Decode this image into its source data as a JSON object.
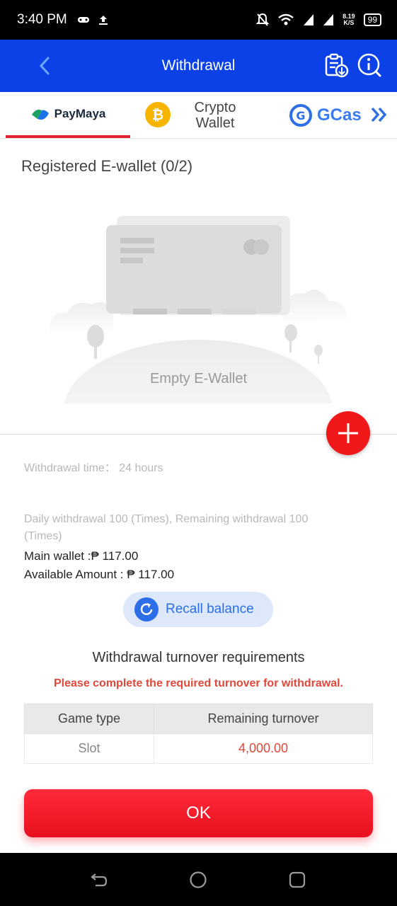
{
  "status_bar": {
    "time": "3:40 PM",
    "net_speed_value": "8.19",
    "net_speed_unit": "K/S",
    "battery": "99"
  },
  "header": {
    "title": "Withdrawal",
    "back_icon": "chevron-left-icon",
    "record_icon": "clipboard-download-icon",
    "info_icon": "info-icon"
  },
  "tabs": [
    {
      "label": "PayMaya",
      "active": true
    },
    {
      "label": "Crypto Wallet",
      "line1": "Crypto",
      "line2": "Wallet",
      "active": false
    },
    {
      "label": "GCash",
      "visible_text": "GCas",
      "active": false
    }
  ],
  "ewallet": {
    "title": "Registered E-wallet (0/2)",
    "empty_label": "Empty E-Wallet"
  },
  "info": {
    "withdrawal_time": "Withdrawal time：  24 hours",
    "daily_withdrawal_line1": "Daily withdrawal 100 (Times), Remaining withdrawal 100",
    "daily_withdrawal_line2": "(Times)",
    "main_wallet": "Main wallet :₱ 117.00",
    "available_amount": "Available Amount : ₱ 117.00"
  },
  "recall_button": {
    "label": "Recall balance"
  },
  "turnover": {
    "title": "Withdrawal turnover requirements",
    "warning": "Please complete the required turnover for withdrawal.",
    "headers": [
      "Game type",
      "Remaining turnover"
    ],
    "rows": [
      {
        "game_type": "Slot",
        "remaining": "4,000.00"
      }
    ]
  },
  "ok_button": {
    "label": "OK"
  },
  "colors": {
    "header_blue": "#0b41e6",
    "accent_red": "#f01818",
    "warning_red": "#e0483a",
    "recall_blue": "#2b6ee8"
  }
}
